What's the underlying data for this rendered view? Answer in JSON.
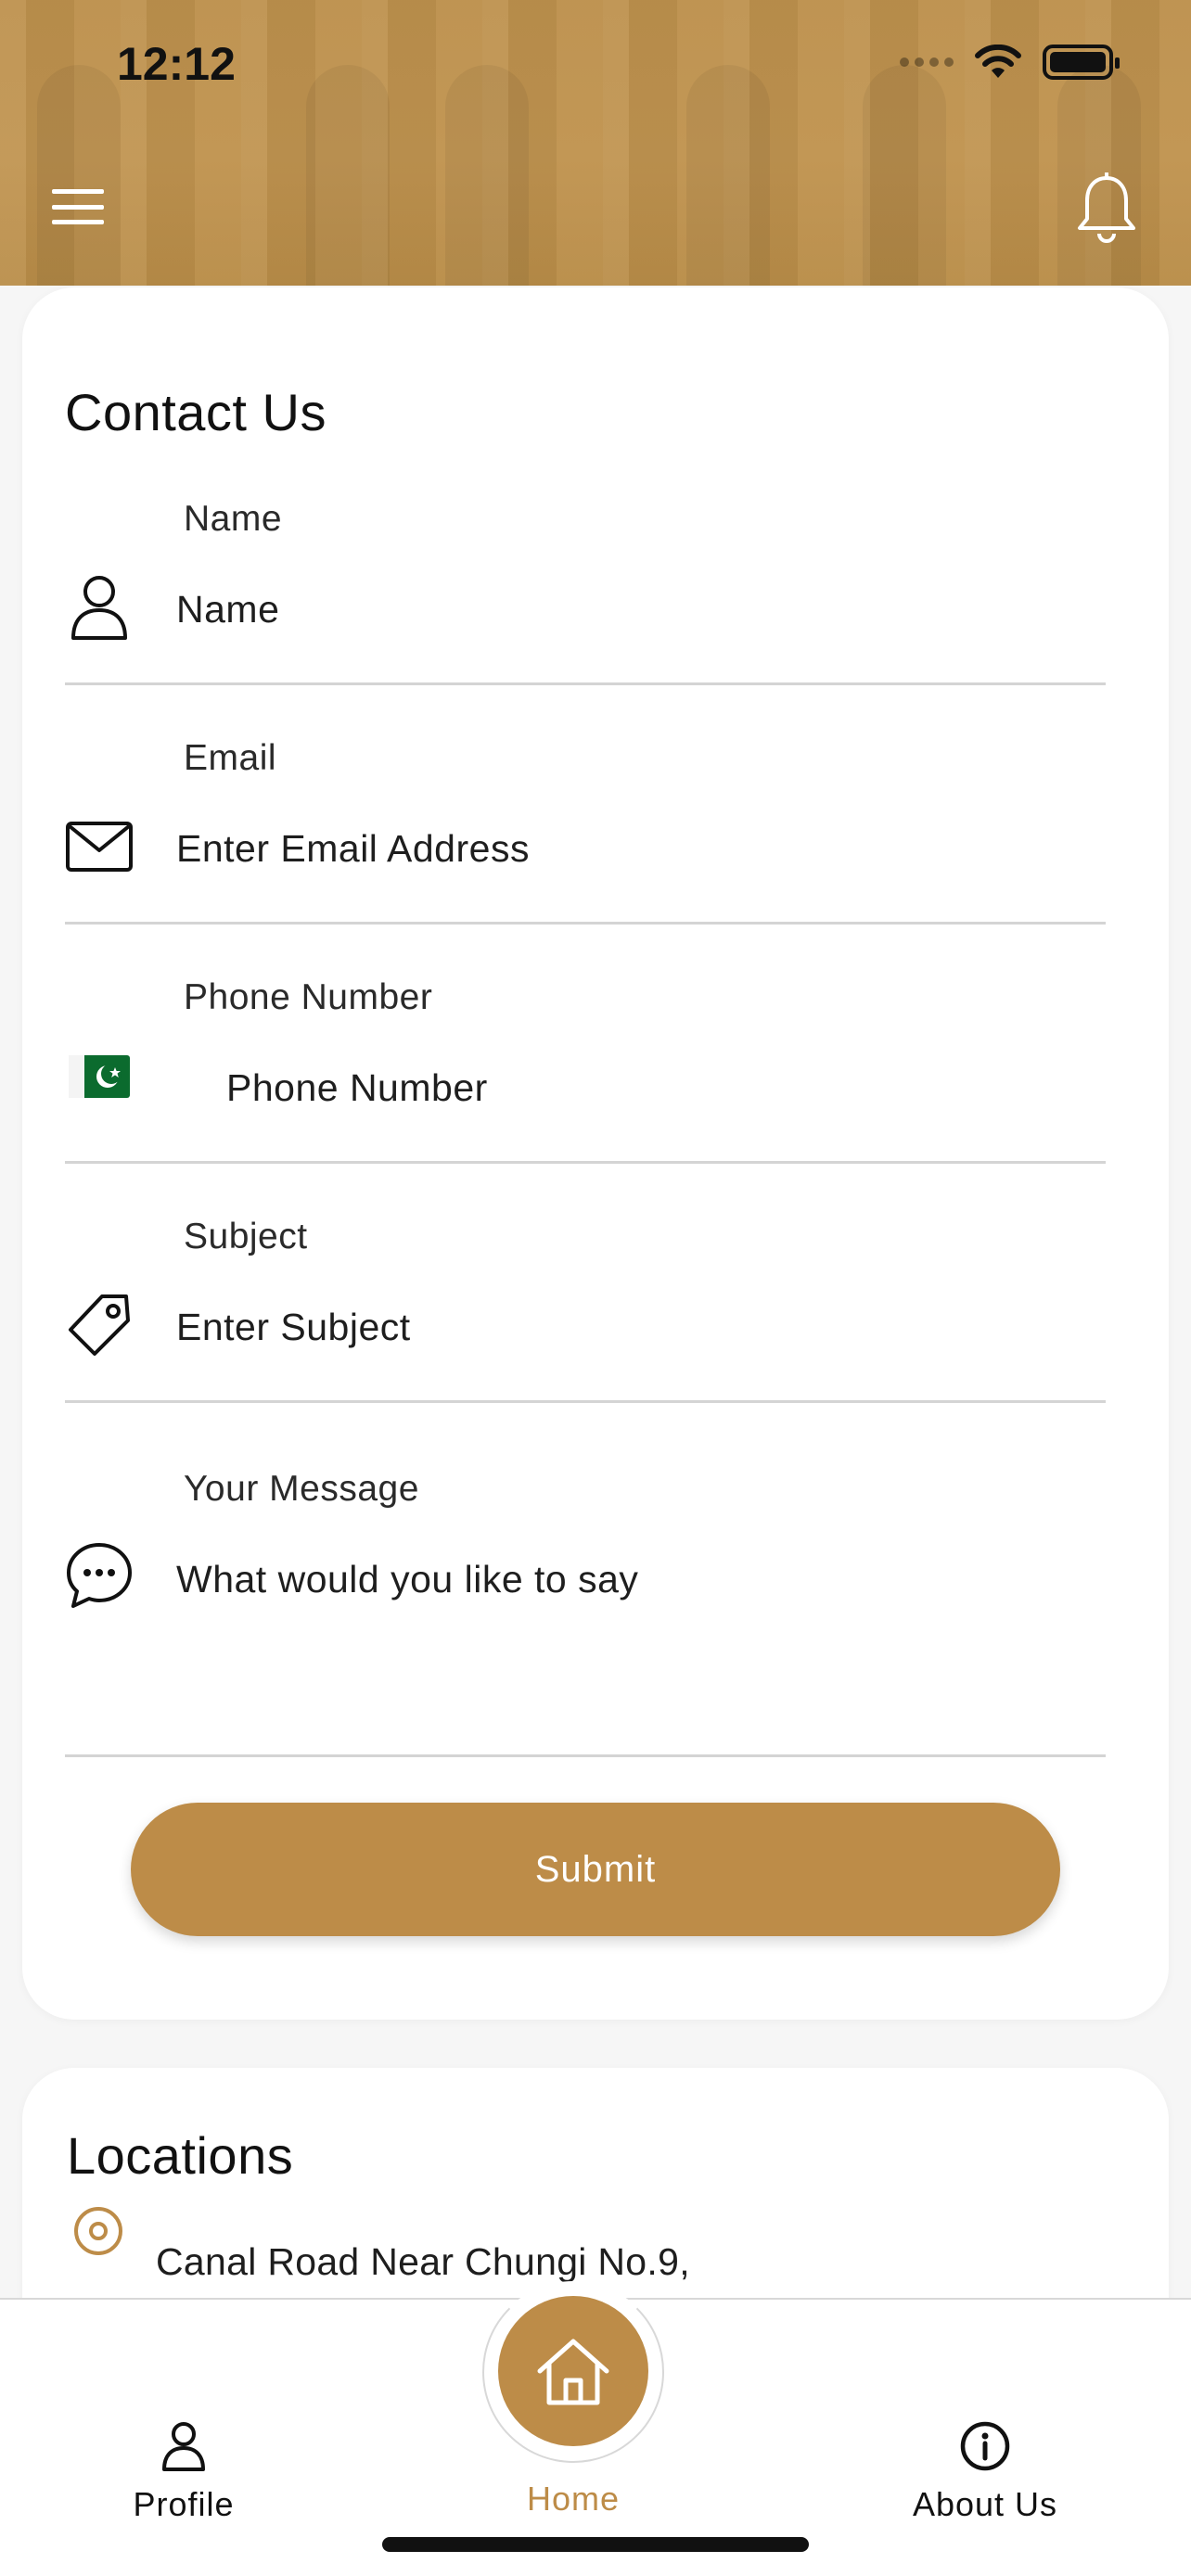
{
  "status_bar": {
    "time": "12:12"
  },
  "header": {
    "menu_icon": "hamburger-menu-icon",
    "notification_icon": "bell-icon"
  },
  "contact": {
    "title": "Contact Us",
    "fields": {
      "name": {
        "label": "Name",
        "placeholder": "Name",
        "icon": "person-icon"
      },
      "email": {
        "label": "Email",
        "placeholder": "Enter Email Address",
        "icon": "envelope-icon"
      },
      "phone": {
        "label": "Phone Number",
        "placeholder": "Phone Number",
        "icon": "pakistan-flag-icon"
      },
      "subject": {
        "label": "Subject",
        "placeholder": "Enter Subject",
        "icon": "tag-icon"
      },
      "message": {
        "label": "Your Message",
        "placeholder": "What would you like to say",
        "icon": "chat-bubble-icon"
      }
    },
    "submit_label": "Submit"
  },
  "locations": {
    "title": "Locations",
    "items": [
      "Canal Road Near Chungi No.9,"
    ]
  },
  "tabbar": {
    "profile_label": "Profile",
    "home_label": "Home",
    "about_label": "About Us"
  },
  "colors": {
    "brand": "#bd8c48",
    "header": "#c09450",
    "divider": "#d4d4d4"
  }
}
